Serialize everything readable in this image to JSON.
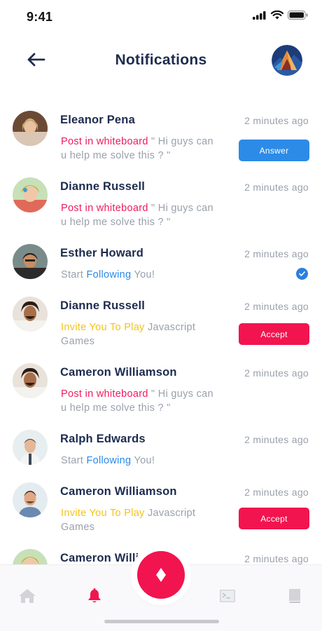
{
  "status_bar": {
    "time": "9:41"
  },
  "header": {
    "title": "Notifications"
  },
  "notifications": [
    {
      "name": "Eleanor Pena",
      "time": "2 minutes ago",
      "highlight": "Post in whiteboard",
      "rest": " \" Hi guys can u help me solve this ? \"",
      "action": "Answer"
    },
    {
      "name": "Dianne Russell",
      "time": "2 minutes ago",
      "highlight": "Post in whiteboard",
      "rest": " \" Hi guys can u help me solve this ? \""
    },
    {
      "name": "Esther Howard",
      "time": "2 minutes ago",
      "pre": "Start ",
      "highlight": "Following",
      "rest": " You!"
    },
    {
      "name": "Dianne Russell",
      "time": "2 minutes ago",
      "highlight": "Invite You To Play",
      "rest": " Javascript Games",
      "action": "Accept"
    },
    {
      "name": "Cameron Williamson",
      "time": "2 minutes ago",
      "highlight": "Post in whiteboard",
      "rest": " \" Hi guys can u help me solve this ? \""
    },
    {
      "name": "Ralph Edwards",
      "time": "2 minutes ago",
      "pre": "Start ",
      "highlight": "Following",
      "rest": " You!"
    },
    {
      "name": "Cameron Williamson",
      "time": "2 minutes ago",
      "highlight": "Invite You To Play",
      "rest": " Javascript Games",
      "action": "Accept"
    },
    {
      "name": "Cameron Willi",
      "time": "2 minutes ago"
    }
  ],
  "bottom_nav": {
    "items": [
      "home-icon",
      "bell-icon",
      "terminal-icon",
      "book-icon"
    ],
    "active": "bell-icon",
    "fab_icon": "diamond-icon"
  },
  "colors": {
    "accent": "#f2144f",
    "blue": "#2c8be7",
    "yellow": "#f2c417",
    "title": "#1e2c4e"
  }
}
